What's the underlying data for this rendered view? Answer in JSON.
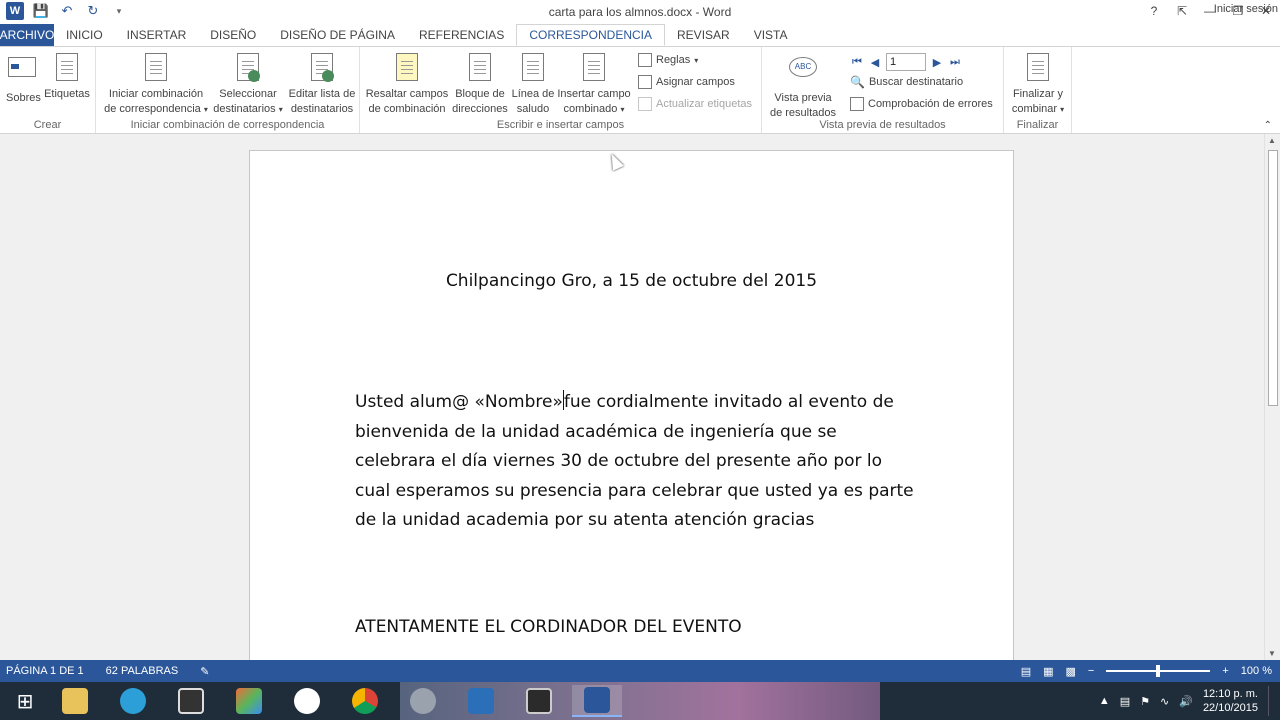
{
  "window": {
    "title": "carta para los almnos.docx - Word",
    "help": "?",
    "sign_in": "Iniciar sesión"
  },
  "tabs": [
    "ARCHIVO",
    "INICIO",
    "INSERTAR",
    "DISEÑO",
    "DISEÑO DE PÁGINA",
    "REFERENCIAS",
    "CORRESPONDENCIA",
    "REVISAR",
    "VISTA"
  ],
  "active_tab": "CORRESPONDENCIA",
  "ribbon": {
    "crear": {
      "label": "Crear",
      "sobres": "Sobres",
      "etiquetas": "Etiquetas"
    },
    "iniciar": {
      "label": "Iniciar combinación de correspondencia",
      "iniciar_1": "Iniciar combinación",
      "iniciar_2": "de correspondencia",
      "seleccionar_1": "Seleccionar",
      "seleccionar_2": "destinatarios",
      "editar_1": "Editar lista de",
      "editar_2": "destinatarios"
    },
    "escribir": {
      "label": "Escribir e insertar campos",
      "resaltar_1": "Resaltar campos",
      "resaltar_2": "de combinación",
      "bloque_1": "Bloque de",
      "bloque_2": "direcciones",
      "linea_1": "Línea de",
      "linea_2": "saludo",
      "insertar_1": "Insertar campo",
      "insertar_2": "combinado",
      "reglas": "Reglas",
      "asignar": "Asignar campos",
      "actualizar": "Actualizar etiquetas"
    },
    "vista": {
      "label": "Vista previa de resultados",
      "vista_1": "Vista previa",
      "vista_2": "de resultados",
      "record": "1",
      "buscar": "Buscar destinatario",
      "comprobacion": "Comprobación de errores"
    },
    "finalizar": {
      "label": "Finalizar",
      "finalizar_1": "Finalizar y",
      "finalizar_2": "combinar"
    }
  },
  "document": {
    "date_line": "Chilpancingo Gro, a 15 de octubre del 2015",
    "para_start": "Usted alum@ «Nombre»",
    "para_rest": "fue cordialmente invitado al evento de bienvenida de la unidad académica de ingeniería que se celebrara  el día viernes 30 de octubre del presente año por lo cual esperamos su presencia para celebrar que usted ya es parte de la unidad academia por su atenta atención gracias",
    "closing": "ATENTAMENTE EL CORDINADOR DEL EVENTO"
  },
  "status": {
    "page": "PÁGINA 1 DE 1",
    "words": "62 PALABRAS",
    "zoom": "100 %"
  },
  "taskbar": {
    "time": "12:10 p. m.",
    "date": "22/10/2015"
  },
  "colors": {
    "accent": "#2b579a",
    "taskbar": "#1f2d3a"
  }
}
